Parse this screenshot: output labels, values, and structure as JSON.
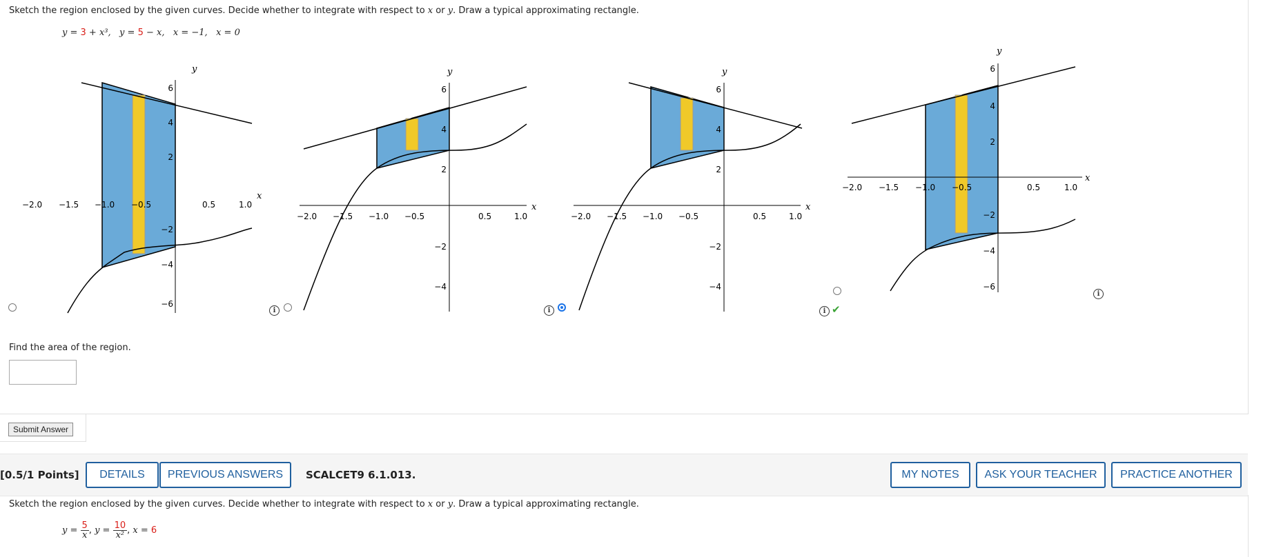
{
  "question1": {
    "instruction_pre": "Sketch the region enclosed by the given curves. Decide whether to integrate with respect to ",
    "var_x": "x",
    "instruction_mid": " or ",
    "var_y": "y",
    "instruction_post": ". Draw a typical approximating rectangle.",
    "formula": {
      "y1_lhs": "y = ",
      "y1_c": "3",
      "y1_rest": " + x³,",
      "y2_lhs": "y = ",
      "y2_c": "5",
      "y2_rest": " − x,",
      "x1": "x = −1,",
      "x2": "x = 0"
    },
    "graph_options": [
      {
        "x_label": "x",
        "y_label": "y",
        "x_ticks": [
          "−2.0",
          "−1.5",
          "−1.0",
          "−0.5",
          "0.5",
          "1.0"
        ],
        "y_ticks": [
          "6",
          "4",
          "2",
          "−2",
          "−4",
          "−6"
        ],
        "selected": false,
        "region": "between y=5−x (top) and y=3+x³ (bottom), x from −1 to 0, vertical rectangle (wrong: shifted down)",
        "radio_value": "false"
      },
      {
        "x_label": "x",
        "y_label": "y",
        "x_ticks": [
          "−2.0",
          "−1.5",
          "−1.0",
          "−0.5",
          "0.5",
          "1.0"
        ],
        "y_ticks": [
          "6",
          "4",
          "2",
          "−2",
          "−4"
        ],
        "selected": false,
        "radio_value": "false"
      },
      {
        "x_label": "x",
        "y_label": "y",
        "x_ticks": [
          "−2.0",
          "−1.5",
          "−1.0",
          "−0.5",
          "0.5",
          "1.0"
        ],
        "y_ticks": [
          "6",
          "4",
          "2",
          "−2",
          "−4"
        ],
        "selected": true,
        "radio_value": "true"
      },
      {
        "x_label": "x",
        "y_label": "y",
        "x_ticks": [
          "−2.0",
          "−1.5",
          "−1.0",
          "−0.5",
          "0.5",
          "1.0"
        ],
        "y_ticks": [
          "6",
          "4",
          "2",
          "−2",
          "−4",
          "−6"
        ],
        "selected": false,
        "radio_value": "false"
      }
    ],
    "find_area_label": "Find the area of the region.",
    "answer_value": "",
    "submit_label": "Submit Answer"
  },
  "toolbar": {
    "points": "[0.5/1 Points]",
    "details": "DETAILS",
    "previous_answers": "PREVIOUS ANSWERS",
    "reference": "SCALCET9 6.1.013.",
    "my_notes": "MY NOTES",
    "ask_teacher": "ASK YOUR TEACHER",
    "practice_another": "PRACTICE ANOTHER"
  },
  "question2": {
    "instruction_pre": "Sketch the region enclosed by the given curves. Decide whether to integrate with respect to ",
    "var_x": "x",
    "instruction_mid": " or ",
    "var_y": "y",
    "instruction_post": ". Draw a typical approximating rectangle.",
    "formula": {
      "y1_lhs": "y = ",
      "y1_num": "5",
      "y1_den": "x",
      "sep1": ",  ",
      "y2_lhs": "y = ",
      "y2_num": "10",
      "y2_den": "x²",
      "sep2": ",  ",
      "x_eq": "x = ",
      "x_val": "6"
    }
  },
  "colors": {
    "region_fill": "#6aaad8",
    "rectangle_fill": "#f0c929",
    "given_constant_red": "#d91e18",
    "button_blue": "#1f5f9e",
    "check_green": "#3aa335",
    "radio_selected": "#1a73e8"
  },
  "icons": [
    "info-icon",
    "check-icon",
    "radio-button"
  ]
}
